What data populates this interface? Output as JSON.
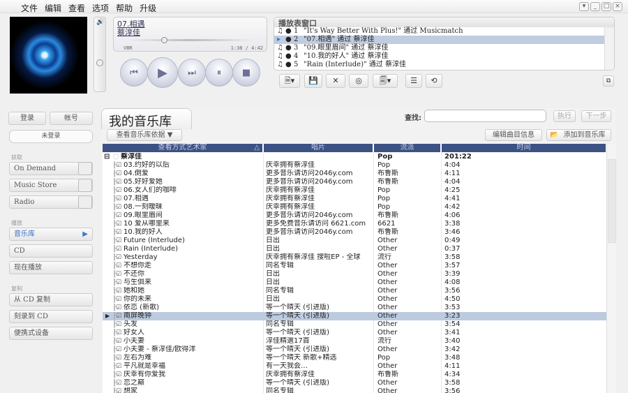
{
  "menu": [
    "文件",
    "编辑",
    "查看",
    "选项",
    "帮助",
    "升级"
  ],
  "window_buttons": [
    "▾",
    "_",
    "□",
    "×"
  ],
  "now_playing": {
    "title": "07.相遇",
    "artist": "蔡淳佳",
    "format": "VBR",
    "time": "1:38 / 4:42"
  },
  "controls": [
    "previous",
    "play",
    "next",
    "pause",
    "stop"
  ],
  "playlist": {
    "header": "播放表窗口",
    "items": [
      {
        "n": "1",
        "text": "\"It's Way Better With Plus!\" 通过 Musicmatch"
      },
      {
        "n": "2",
        "text": "\"07.相遇\" 通过 蔡淳佳",
        "selected": true
      },
      {
        "n": "3",
        "text": "\"09.眼里眉间\" 通过 蔡淳佳"
      },
      {
        "n": "4",
        "text": "\"10.我的好人\" 通过 蔡淳佳"
      },
      {
        "n": "5",
        "text": "\"Rain (Interlude)\" 通过 蔡淳佳"
      }
    ]
  },
  "sidebar": {
    "login": "登录",
    "account": "帐号",
    "status": "未登录",
    "sections": [
      {
        "label": "获取",
        "items": [
          "On Demand",
          "Music Store",
          "Radio"
        ]
      },
      {
        "label": "播放",
        "items": [
          "音乐库",
          "CD",
          "现在播放"
        ]
      },
      {
        "label": "复制",
        "items": [
          "从 CD 复制",
          "刻录到 CD",
          "便携式设备"
        ]
      }
    ]
  },
  "library": {
    "title": "我的音乐库",
    "view_by": "查看音乐库依据 ▼",
    "search_label": "查找:",
    "search_value": "",
    "execute": "执行",
    "next": "下一步",
    "edit_info": "编辑曲目信息",
    "add_to_library": "添加到音乐库",
    "columns": [
      "查看方式艺术家",
      "唱片",
      "流派",
      "时间"
    ],
    "group": {
      "artist": "蔡淳佳",
      "genre": "Pop",
      "time": "201:22"
    },
    "rows": [
      [
        "03.约好的以后",
        "庆幸拥有蔡淳佳",
        "Pop",
        "4:04"
      ],
      [
        "04.倒爱",
        "更多音乐请访问2046y.com",
        "布鲁斯",
        "4:11"
      ],
      [
        "05.好好爱她",
        "更多音乐请访问2046y.com",
        "布鲁斯",
        "4:04"
      ],
      [
        "06.女人们的咖啡",
        "庆幸拥有蔡淳佳",
        "Pop",
        "4:25"
      ],
      [
        "07.相遇",
        "庆幸拥有蔡淳佳",
        "Pop",
        "4:41"
      ],
      [
        "08.一刻暧昧",
        "庆幸拥有蔡淳佳",
        "Pop",
        "4:42"
      ],
      [
        "09.眼里眉间",
        "更多音乐请访问2046y.com",
        "布鲁斯",
        "4:06"
      ],
      [
        "10 爱从哪里来",
        "更多免费音乐请访问 6621.com",
        "6621",
        "3:38"
      ],
      [
        "10.我的好人",
        "更多音乐请访问2046y.com",
        "布鲁斯",
        "3:46"
      ],
      [
        "Future (Interlude)",
        "日出",
        "Other",
        "0:49"
      ],
      [
        "Rain (Interlude)",
        "日出",
        "Other",
        "0:37"
      ],
      [
        "Yesterday",
        "庆幸拥有蔡淳佳 搜啦EP - 全球",
        "流行",
        "3:58"
      ],
      [
        "不想你走",
        "同名专辑",
        "Other",
        "3:57"
      ],
      [
        "不还你",
        "日出",
        "Other",
        "3:39"
      ],
      [
        "与生俱来",
        "日出",
        "Other",
        "4:08"
      ],
      [
        "她和她",
        "同名专辑",
        "Other",
        "3:56"
      ],
      [
        "你的未来",
        "日出",
        "Other",
        "4:50"
      ],
      [
        "依恋 (新歌)",
        "等一个晴天 (引进版)",
        "Other",
        "3:53"
      ],
      [
        "南屏晚钟",
        "等一个晴天 (引进版)",
        "Other",
        "3:23"
      ],
      [
        "头发",
        "同名专辑",
        "Other",
        "3:54"
      ],
      [
        "好女人",
        "等一个晴天 (引进版)",
        "Other",
        "3:41"
      ],
      [
        "小夫妻",
        "淳佳精選17首",
        "流行",
        "3:40"
      ],
      [
        "小夫妻 - 蔡淳佳/欧得洋",
        "等一个晴天 (引进版)",
        "Other",
        "3:42"
      ],
      [
        "左右为难",
        "等一个晴天 新歌+精选",
        "Pop",
        "3:48"
      ],
      [
        "平凡就是幸福",
        "有一天我会…",
        "Other",
        "4:11"
      ],
      [
        "庆幸有你爱我",
        "庆幸拥有蔡淳佳",
        "布鲁斯",
        "4:34"
      ],
      [
        "恋之巅",
        "等一个晴天 (引进版)",
        "Other",
        "3:58"
      ],
      [
        "想家",
        "同名专辑",
        "Other",
        "3:56"
      ]
    ],
    "selected_row": 18
  }
}
